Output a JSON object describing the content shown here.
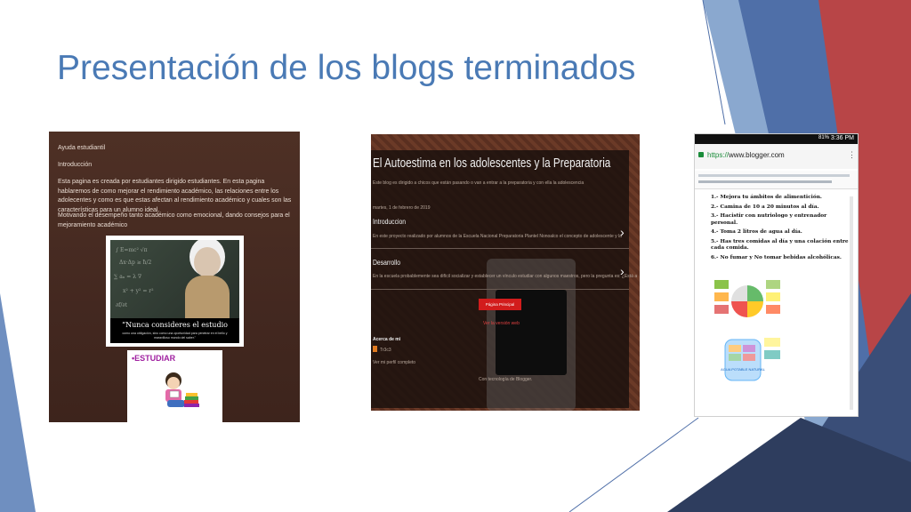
{
  "slide": {
    "title": "Presentación de los blogs terminados",
    "colors": {
      "title": "#4a7ab5",
      "accent_blue": "#4f6fa8",
      "accent_red": "#b84547",
      "accent_dark": "#2e3d5e"
    }
  },
  "blog1": {
    "heading": "Ayuda estudiantil",
    "section": "Introducción",
    "paragraph1": "Esta pagina es creada por estudiantes dirigido estudiantes. En esta pagina hablaremos de como mejorar el rendimiento académico, las relaciones entre los adolecentes y como es que estas afectan al rendimiento académico y cuales son las características para un alumno ideal.",
    "paragraph2": "Motivando el desempeño tanto académico como emocional, dando consejos para el mejoramiento académico",
    "image_quote": "“Nunca consideres el estudio",
    "image_quote_sub": "como una obligación, sino como una oportunidad para penetrar en el bello y maravilloso mundo del saber.”",
    "image2_label": "•ESTUDIAR"
  },
  "blog2": {
    "title": "El Autoestima en los adolescentes y la Preparatoria",
    "description": "Este blog es dirigido a chicos que están pasando o van a entrar a la preparatoria y con ella la adolescencia",
    "date": "martes, 1 de febrero de 2019",
    "post1_title": "Introduccion",
    "post1_snippet": "En este proyecto realizado por alumnos de la Escuela Nacional Preparatoria Plantel Nonoalco el concepto de adolescente y la",
    "post2_title": "Desarrollo",
    "post2_snippet": "En la escuela probablemente sea difícil socializar y establecer un vínculo estudiar con algunos maestros, pero la pregunta es: ¿Está a",
    "home_button": "Página Principal",
    "web_version": "Ver la versión web",
    "about_heading": "Acerca de mi",
    "author": "Tr3c3",
    "profile_link": "Ver mi perfil completo",
    "powered": "Con tecnología de Blogger."
  },
  "blog3": {
    "time": "3:36 PM",
    "battery": "81%",
    "url_scheme": "https://",
    "url_host": "www.blogger.com",
    "items": [
      "1.- Mejora tu ámbitos de alimentición.",
      "2.- Camina de 10 a 20 minutos al día.",
      "3.- Hacistir con nutriologo y entrenador personal.",
      "4.- Toma 2 litros de agua al día.",
      "5.- Has tres comidas al día y una colación entre cada comida.",
      "6.- No fumar y No tomar bebidas alcohólicas."
    ],
    "jar_label": "AGUA POTABLE NATURAL"
  }
}
